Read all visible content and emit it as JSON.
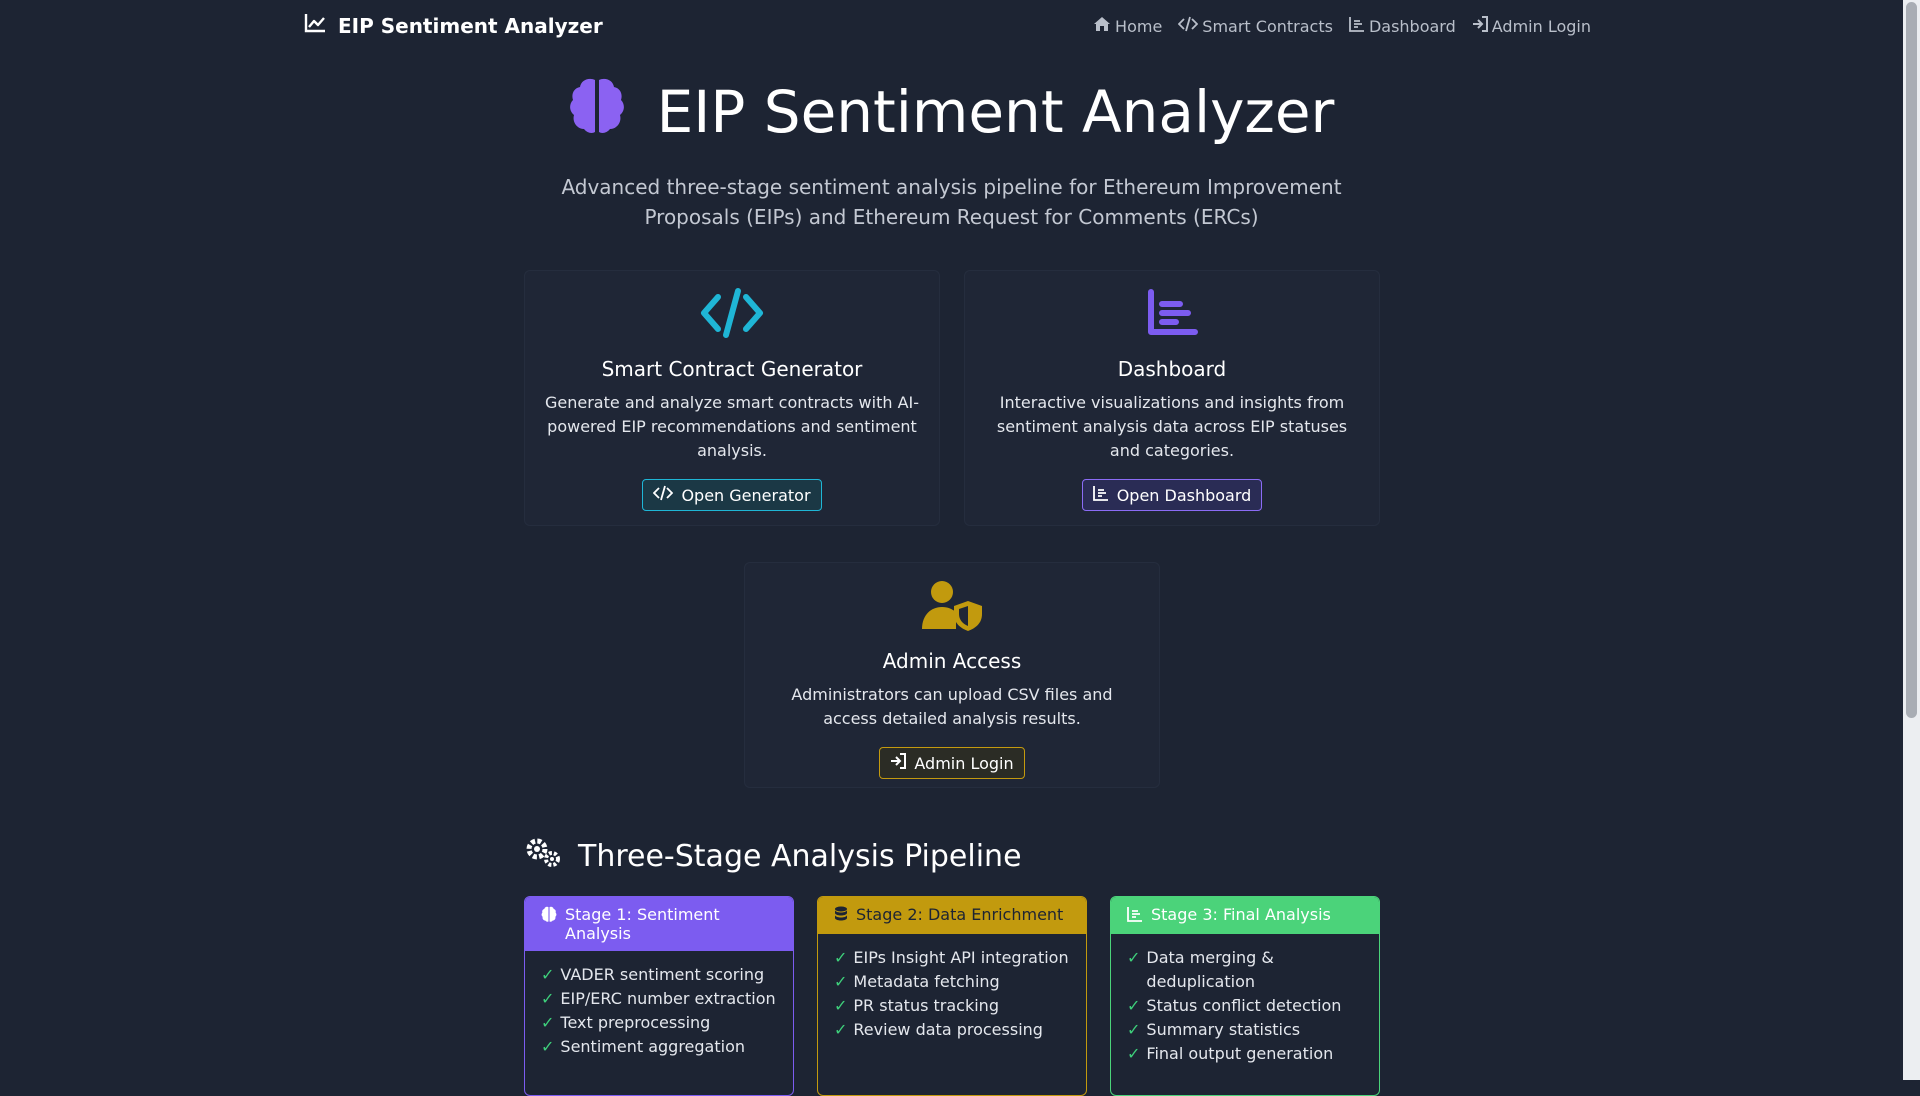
{
  "colors": {
    "background": "#1d2433",
    "cyan": "#1fb6d6",
    "purple": "#7c5cf0",
    "gold": "#c29a0e",
    "green": "#4bd37a"
  },
  "navbar": {
    "brand": "EIP Sentiment Analyzer",
    "links": [
      {
        "label": "Home",
        "icon": "home-icon"
      },
      {
        "label": "Smart Contracts",
        "icon": "code-icon"
      },
      {
        "label": "Dashboard",
        "icon": "chart-icon"
      },
      {
        "label": "Admin Login",
        "icon": "sign-in-icon"
      }
    ]
  },
  "hero": {
    "title": "EIP Sentiment Analyzer",
    "subtitle": "Advanced three-stage sentiment analysis pipeline for Ethereum Improvement Proposals (EIPs) and Ethereum Request for Comments (ERCs)"
  },
  "cards": {
    "generator": {
      "title": "Smart Contract Generator",
      "text": "Generate and analyze smart contracts with AI-powered EIP recommendations and sentiment analysis.",
      "button": "Open Generator"
    },
    "dashboard": {
      "title": "Dashboard",
      "text": "Interactive visualizations and insights from sentiment analysis data across EIP statuses and categories.",
      "button": "Open Dashboard"
    },
    "admin": {
      "title": "Admin Access",
      "text": "Administrators can upload CSV files and access detailed analysis results.",
      "button": "Admin Login"
    }
  },
  "pipeline": {
    "heading": "Three-Stage Analysis Pipeline",
    "stages": [
      {
        "title": "Stage 1: Sentiment Analysis",
        "items": [
          "VADER sentiment scoring",
          "EIP/ERC number extraction",
          "Text preprocessing",
          "Sentiment aggregation"
        ]
      },
      {
        "title": "Stage 2: Data Enrichment",
        "items": [
          "EIPs Insight API integration",
          "Metadata fetching",
          "PR status tracking",
          "Review data processing"
        ]
      },
      {
        "title": "Stage 3: Final Analysis",
        "items": [
          "Data merging & deduplication",
          "Status conflict detection",
          "Summary statistics",
          "Final output generation"
        ]
      }
    ]
  }
}
